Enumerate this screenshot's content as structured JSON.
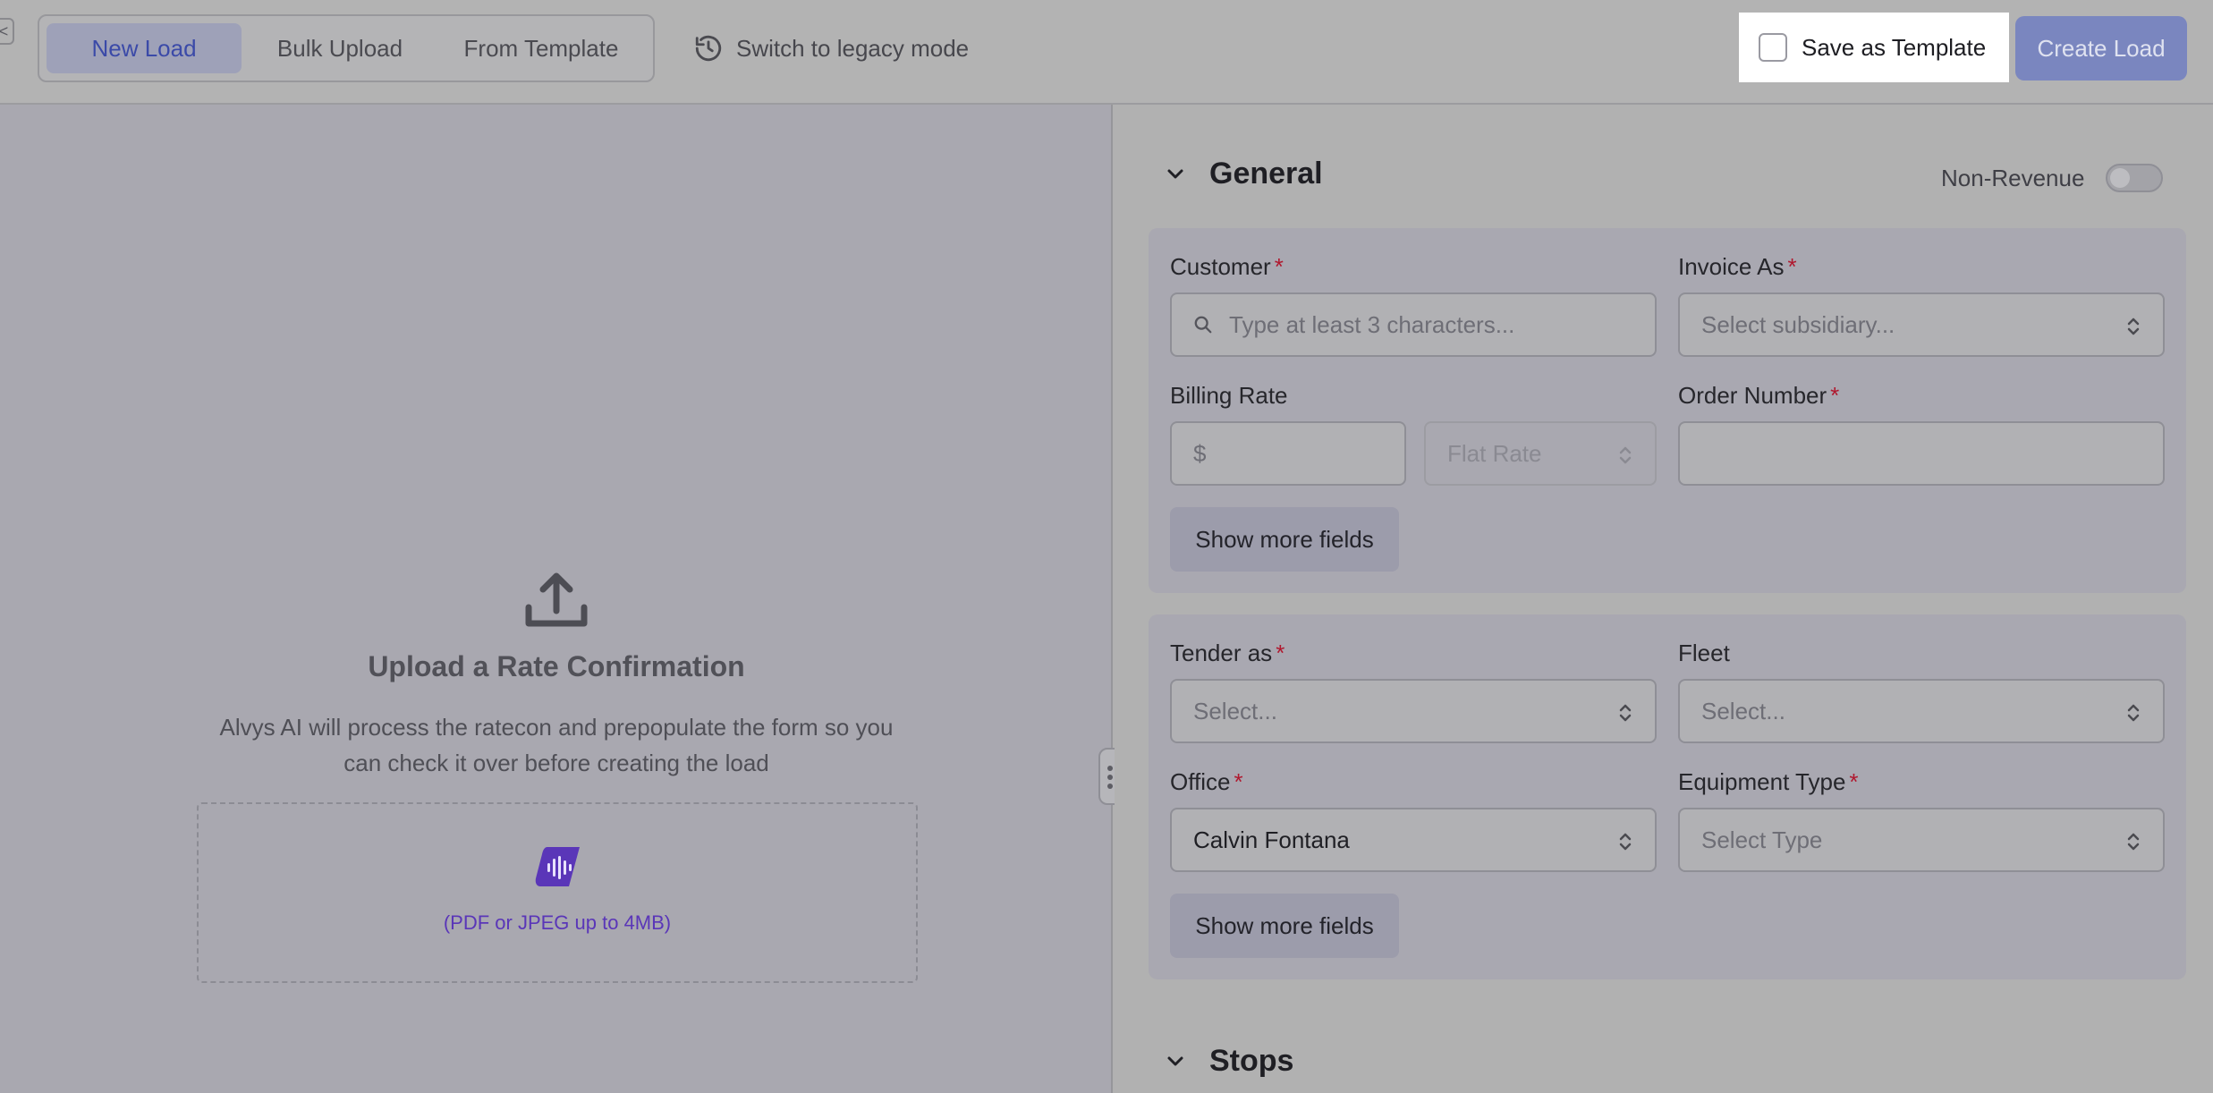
{
  "topbar": {
    "tabs": [
      {
        "label": "New Load",
        "active": true
      },
      {
        "label": "Bulk Upload",
        "active": false
      },
      {
        "label": "From Template",
        "active": false
      }
    ],
    "legacy_label": "Switch to legacy mode",
    "save_template_label": "Save as Template",
    "save_template_checked": false,
    "create_label": "Create Load",
    "edge_tab_glyph": "<"
  },
  "upload": {
    "title": "Upload a Rate Confirmation",
    "description": "Alvys AI will process the ratecon and prepopulate the form so you can check it over before creating the load",
    "hint": "(PDF or JPEG up to 4MB)"
  },
  "general": {
    "title": "General",
    "non_revenue_label": "Non-Revenue",
    "non_revenue_on": false,
    "customer": {
      "label": "Customer",
      "placeholder": "Type at least 3 characters..."
    },
    "invoice_as": {
      "label": "Invoice As",
      "placeholder": "Select subsidiary..."
    },
    "billing_rate": {
      "label": "Billing Rate",
      "prefix": "$",
      "rate_type": "Flat Rate"
    },
    "order_number": {
      "label": "Order Number",
      "value": ""
    },
    "show_more_1": "Show more fields",
    "tender_as": {
      "label": "Tender as",
      "placeholder": "Select..."
    },
    "fleet": {
      "label": "Fleet",
      "placeholder": "Select..."
    },
    "office": {
      "label": "Office",
      "value": "Calvin Fontana"
    },
    "equipment_type": {
      "label": "Equipment Type",
      "placeholder": "Select Type"
    },
    "show_more_2": "Show more fields",
    "required_mark": "*"
  },
  "stops": {
    "title": "Stops"
  },
  "colors": {
    "accent": "#3b4aa8",
    "create_button": "#7a86bf",
    "required": "#b0182e",
    "ai_logo": "#5a36b8"
  }
}
